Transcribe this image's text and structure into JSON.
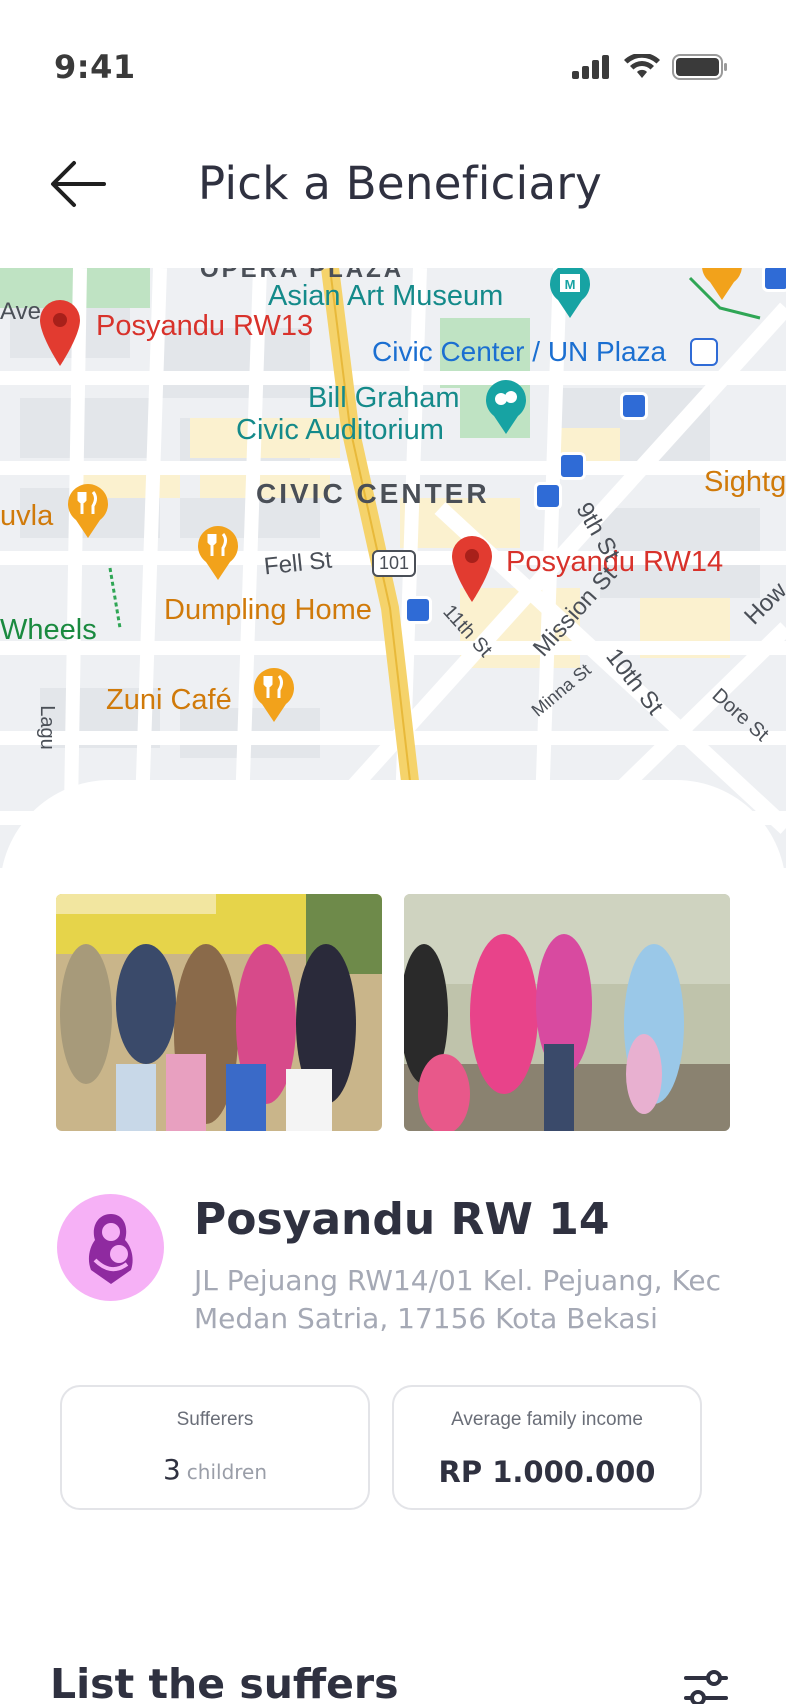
{
  "status": {
    "time": "9:41"
  },
  "header": {
    "title": "Pick a Beneficiary"
  },
  "map": {
    "labels": {
      "asian_art_museum": "Asian Art Museum",
      "posyandu_rw13": "Posyandu RW13",
      "civic_center_un": "Civic Center / UN Plaza",
      "bill_graham_1": "Bill Graham",
      "bill_graham_2": "Civic Auditorium",
      "civic_center": "CIVIC CENTER",
      "posyandu_rw14": "Posyandu RW14",
      "fell_st": "Fell St",
      "us101": "101",
      "dumpling_home": "Dumpling Home",
      "zuni_cafe": "Zuni Café",
      "uvla": "uvla",
      "wheels": "Wheels",
      "ave": "Ave",
      "sight": "Sightg",
      "ninth_st": "9th St",
      "mission_st": "Mission St",
      "tenth_st": "10th St",
      "eleventh_st": "11th St",
      "minna_st": "Minna St",
      "dore_st": "Dore St",
      "how": "How",
      "lagu": "Lagu",
      "opera_plaza": "OPERA PLAZA"
    }
  },
  "facility": {
    "name": "Posyandu RW 14",
    "address": "JL Pejuang RW14/01 Kel. Pejuang, Kec Medan Satria, 17156 Kota Bekasi",
    "avatar_color": "#f6b1f6"
  },
  "stats": {
    "sufferers": {
      "label": "Sufferers",
      "value": "3",
      "unit": "children"
    },
    "income": {
      "label": "Average family income",
      "value": "RP 1.000.000"
    }
  },
  "list": {
    "title": "List the suffers"
  },
  "colors": {
    "accent": "#d8322b",
    "avatar": "#f6b1f6",
    "card_border": "#e3e4e8"
  }
}
